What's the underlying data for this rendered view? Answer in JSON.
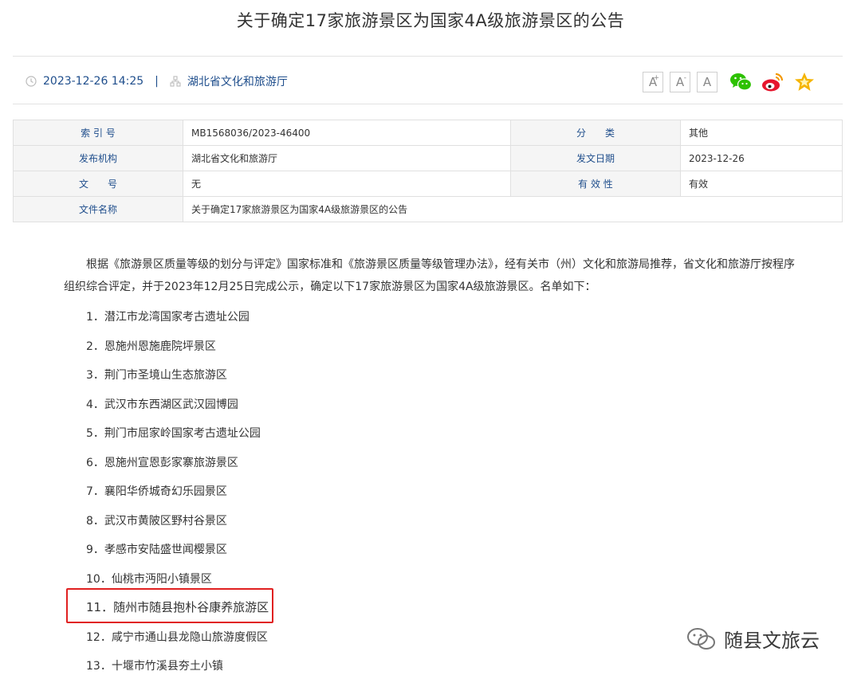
{
  "title": "关于确定17家旅游景区为国家4A级旅游景区的公告",
  "meta": {
    "datetime": "2023-12-26 14:25",
    "separator": "|",
    "source": "湖北省文化和旅游厅",
    "font_buttons": [
      "A",
      "A",
      "A"
    ],
    "font_button_sups": [
      "+",
      "-",
      ""
    ]
  },
  "info": {
    "rows": [
      {
        "l1": "索 引 号",
        "v1": "MB1568036/2023-46400",
        "l2": "分　　类",
        "v2": "其他"
      },
      {
        "l1": "发布机构",
        "v1": "湖北省文化和旅游厅",
        "l2": "发文日期",
        "v2": "2023-12-26"
      },
      {
        "l1": "文　　号",
        "v1": "无",
        "l2": "有 效 性",
        "v2": "有效"
      }
    ],
    "name_label": "文件名称",
    "name_value": "关于确定17家旅游景区为国家4A级旅游景区的公告"
  },
  "body": {
    "paragraph": "根据《旅游景区质量等级的划分与评定》国家标准和《旅游景区质量等级管理办法》，经有关市（州）文化和旅游局推荐，省文化和旅游厅按程序组织综合评定，并于2023年12月25日完成公示，确定以下17家旅游景区为国家4A级旅游景区。名单如下：",
    "items": [
      "1．潜江市龙湾国家考古遗址公园",
      "2．恩施州恩施鹿院坪景区",
      "3．荆门市圣境山生态旅游区",
      "4．武汉市东西湖区武汉园博园",
      "5．荆门市屈家岭国家考古遗址公园",
      "6．恩施州宣恩彭家寨旅游景区",
      "7．襄阳华侨城奇幻乐园景区",
      "8．武汉市黄陂区野村谷景区",
      "9．孝感市安陆盛世闻樱景区",
      "10．仙桃市沔阳小镇景区",
      "11．随州市随县抱朴谷康养旅游区",
      "12．咸宁市通山县龙隐山旅游度假区",
      "13．十堰市竹溪县夯土小镇"
    ]
  },
  "watermark": "随县文旅云",
  "colors": {
    "accent": "#1f4e8c",
    "highlight": "#e02020",
    "wechat": "#2dc100",
    "weibo": "#e6162d",
    "star": "#f5b400"
  }
}
